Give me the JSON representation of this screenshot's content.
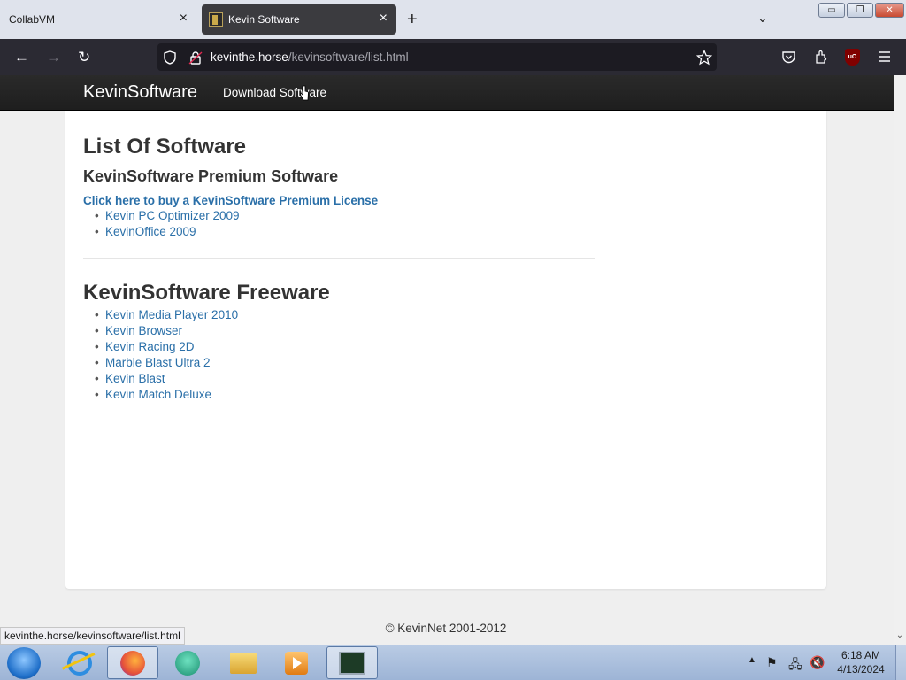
{
  "browser": {
    "tabs": [
      {
        "title": "CollabVM",
        "close": "×"
      },
      {
        "title": "Kevin Software",
        "close": "×"
      }
    ],
    "new_tab_icon": "+",
    "tab_list_icon": "⌄",
    "window_controls": {
      "minimize": "▭",
      "maximize": "❐",
      "close": "✕"
    },
    "nav": {
      "back": "←",
      "forward": "→",
      "reload": "↻"
    },
    "url": {
      "host": "kevinthe.horse",
      "path": "/kevinsoftware/list.html"
    },
    "toolbar_icons": [
      "shield-icon",
      "lock-icon",
      "star-icon",
      "pocket-icon",
      "extensions-icon",
      "ublock-icon",
      "menu-icon"
    ],
    "ublock_label": "uO",
    "status_url": "kevinthe.horse/kevinsoftware/list.html"
  },
  "site": {
    "brand": "KevinSoftware",
    "nav_link": "Download Software",
    "title": "List Of Software",
    "premium": {
      "heading": "KevinSoftware Premium Software",
      "license_link": "Click here to buy a KevinSoftware Premium License",
      "items": [
        "Kevin PC Optimizer 2009",
        "KevinOffice 2009"
      ]
    },
    "freeware": {
      "heading": "KevinSoftware Freeware",
      "items": [
        "Kevin Media Player 2010",
        "Kevin Browser",
        "Kevin Racing 2D",
        "Marble Blast Ultra 2",
        "Kevin Blast",
        "Kevin Match Deluxe"
      ]
    },
    "footer": "© KevinNet 2001-2012"
  },
  "taskbar": {
    "apps": [
      "internet-explorer",
      "firefox",
      "chat",
      "file-explorer",
      "media-player",
      "monitor"
    ],
    "active_app": "firefox",
    "clock_time": "6:18 AM",
    "clock_date": "4/13/2024"
  },
  "colors": {
    "link": "#2a6fa8",
    "navbar": "#1e1e1e",
    "browser_chrome": "#2b2a33"
  }
}
